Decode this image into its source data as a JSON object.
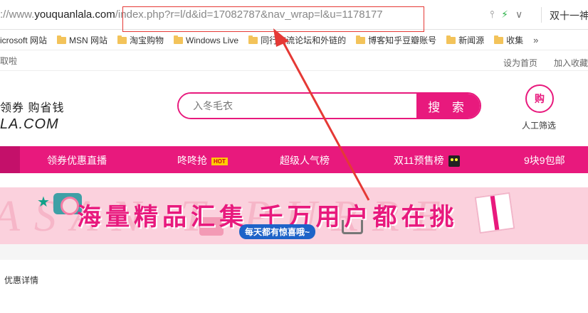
{
  "browser": {
    "url_prefix": "://www.",
    "url_host": "youquanlala.com",
    "url_path": "/index.php?r=l/d&id=17082787&nav_wrap=l&u=1178177",
    "share_icon": "share-icon",
    "bolt_icon": "lightning-icon",
    "chevron_icon": "chevron-down-icon",
    "extension_text": "双十一神"
  },
  "bookmarks": {
    "items": [
      {
        "label": "icrosoft 网站",
        "icon": "none"
      },
      {
        "label": "MSN 网站",
        "icon": "folder"
      },
      {
        "label": "淘宝购物",
        "icon": "folder"
      },
      {
        "label": "Windows Live",
        "icon": "folder"
      },
      {
        "label": "同行交流论坛和外链的",
        "icon": "folder"
      },
      {
        "label": "博客知乎豆瓣账号",
        "icon": "folder"
      },
      {
        "label": "新闻源",
        "icon": "folder"
      },
      {
        "label": "收集",
        "icon": "folder"
      }
    ],
    "more": "»"
  },
  "topstrip": {
    "left_text": "取啦",
    "set_home": "设为首页",
    "add_fav": "加入收藏"
  },
  "header": {
    "slogan": "领券  购省钱",
    "logo": "LA.COM",
    "search_placeholder": "入冬毛衣",
    "search_button": "搜 索",
    "buy_badge": "购",
    "buy_label": "人工筛选"
  },
  "nav": {
    "items": [
      {
        "label": "领券优惠直播"
      },
      {
        "label": "咚咚抢",
        "badge": "HOT"
      },
      {
        "label": "超级人气榜"
      },
      {
        "label": "双11预售榜"
      },
      {
        "label": "9块9包邮"
      }
    ]
  },
  "banner": {
    "background_text": "ASAN  T  PURRE",
    "title": "海量精品汇集  千万用户都在挑",
    "subtitle": "每天都有惊喜哦~"
  },
  "content": {
    "detail_label": "优惠详情"
  },
  "colors": {
    "brand": "#e8197d",
    "annotation": "#e53935"
  }
}
